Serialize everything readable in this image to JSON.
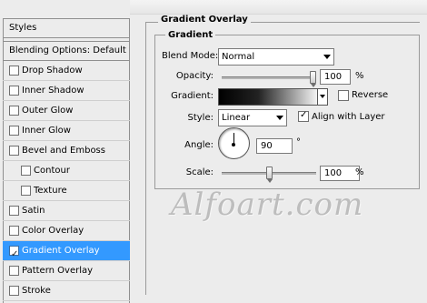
{
  "styles_panel": {
    "header": "Styles",
    "blending_options": "Blending Options: Default",
    "items": [
      {
        "label": "Drop Shadow",
        "checked": false
      },
      {
        "label": "Inner Shadow",
        "checked": false
      },
      {
        "label": "Outer Glow",
        "checked": false
      },
      {
        "label": "Inner Glow",
        "checked": false
      },
      {
        "label": "Bevel and Emboss",
        "checked": false
      },
      {
        "label": "Contour",
        "checked": false
      },
      {
        "label": "Texture",
        "checked": false
      },
      {
        "label": "Satin",
        "checked": false
      },
      {
        "label": "Color Overlay",
        "checked": false
      },
      {
        "label": "Gradient Overlay",
        "checked": true,
        "selected": true
      },
      {
        "label": "Pattern Overlay",
        "checked": false
      },
      {
        "label": "Stroke",
        "checked": false
      }
    ]
  },
  "options": {
    "section_title": "Gradient Overlay",
    "group_title": "Gradient",
    "blend_mode": {
      "label": "Blend Mode:",
      "value": "Normal"
    },
    "opacity": {
      "label": "Opacity:",
      "value": "100",
      "unit": "%",
      "level": 1.0
    },
    "gradient": {
      "label": "Gradient:",
      "reverse_label": "Reverse",
      "reverse_checked": false,
      "colors": [
        "#000000",
        "#f4f4f4"
      ]
    },
    "style": {
      "label": "Style:",
      "value": "Linear",
      "align_label": "Align with Layer",
      "align_checked": true
    },
    "angle": {
      "label": "Angle:",
      "value": "90",
      "unit": "°"
    },
    "scale": {
      "label": "Scale:",
      "value": "100",
      "unit": "%",
      "level": 0.5
    }
  },
  "watermark": "Alfoart.com",
  "colors": {
    "selection": "#3399ff",
    "panel_bg": "#ececec"
  }
}
